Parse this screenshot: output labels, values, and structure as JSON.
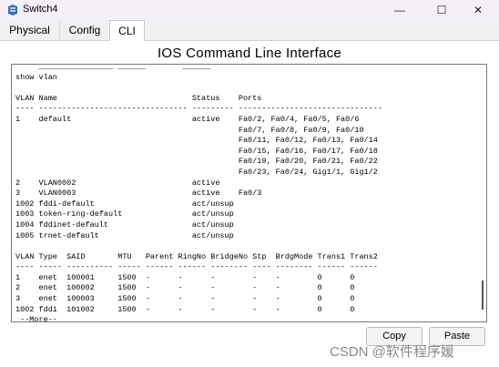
{
  "window": {
    "title": "Switch4",
    "minimize_glyph": "—",
    "maximize_glyph": "☐",
    "close_glyph": "✕"
  },
  "tabs": [
    {
      "label": "Physical"
    },
    {
      "label": "Config"
    },
    {
      "label": "CLI",
      "active": true
    }
  ],
  "heading": "IOS Command Line Interface",
  "terminal": {
    "text": "     ________________ ______        ______   \nshow vlan\n\nVLAN Name                             Status    Ports\n---- -------------------------------- --------- -------------------------------\n1    default                          active    Fa0/2, Fa0/4, Fa0/5, Fa0/6\n                                                Fa0/7, Fa0/8, Fa0/9, Fa0/10\n                                                Fa0/11, Fa0/12, Fa0/13, Fa0/14\n                                                Fa0/15, Fa0/16, Fa0/17, Fa0/18\n                                                Fa0/19, Fa0/20, Fa0/21, Fa0/22\n                                                Fa0/23, Fa0/24, Gig1/1, Gig1/2\n2    VLAN0002                         active\n3    VLAN0003                         active    Fa0/3\n1002 fddi-default                     act/unsup\n1003 token-ring-default               act/unsup\n1004 fddinet-default                  act/unsup\n1005 trnet-default                    act/unsup\n\nVLAN Type  SAID       MTU   Parent RingNo BridgeNo Stp  BrdgMode Trans1 Trans2\n---- ----- ---------- ----- ------ ------ -------- ---- -------- ------ ------\n1    enet  100001     1500  -      -      -        -    -        0      0\n2    enet  100002     1500  -      -      -        -    -        0      0\n3    enet  100003     1500  -      -      -        -    -        0      0\n1002 fddi  101002     1500  -      -      -        -    -        0      0\n --More--"
  },
  "buttons": {
    "copy": "Copy",
    "paste": "Paste"
  },
  "watermark": "CSDN @软件程序媛"
}
